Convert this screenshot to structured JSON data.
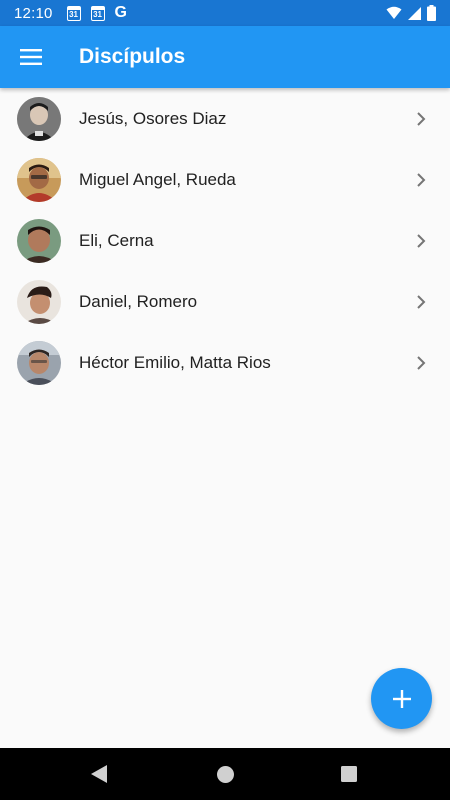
{
  "status_bar": {
    "time": "12:10",
    "calendar_day_1": "31",
    "calendar_day_2": "31",
    "g_label": "G"
  },
  "app_bar": {
    "title": "Discípulos",
    "color": "#2196f3"
  },
  "list": {
    "items": [
      {
        "name": "Jesús, Osores Diaz",
        "avatar_bg": "#6d6d6d",
        "avatar_fg": "#1c1c1c"
      },
      {
        "name": "Miguel Angel, Rueda",
        "avatar_bg": "#c79a5a",
        "avatar_fg": "#3a2617"
      },
      {
        "name": "Eli, Cerna",
        "avatar_bg": "#7a9b80",
        "avatar_fg": "#3b2a22"
      },
      {
        "name": "Daniel, Romero",
        "avatar_bg": "#e9e4de",
        "avatar_fg": "#2a1c17"
      },
      {
        "name": "Héctor Emilio, Matta Rios",
        "avatar_bg": "#9aa3ad",
        "avatar_fg": "#2e2623"
      }
    ]
  },
  "fab": {
    "icon": "plus-icon"
  },
  "nav_bar": {
    "back_icon": "back-triangle-icon",
    "home_icon": "home-circle-icon",
    "recents_icon": "recents-square-icon"
  }
}
